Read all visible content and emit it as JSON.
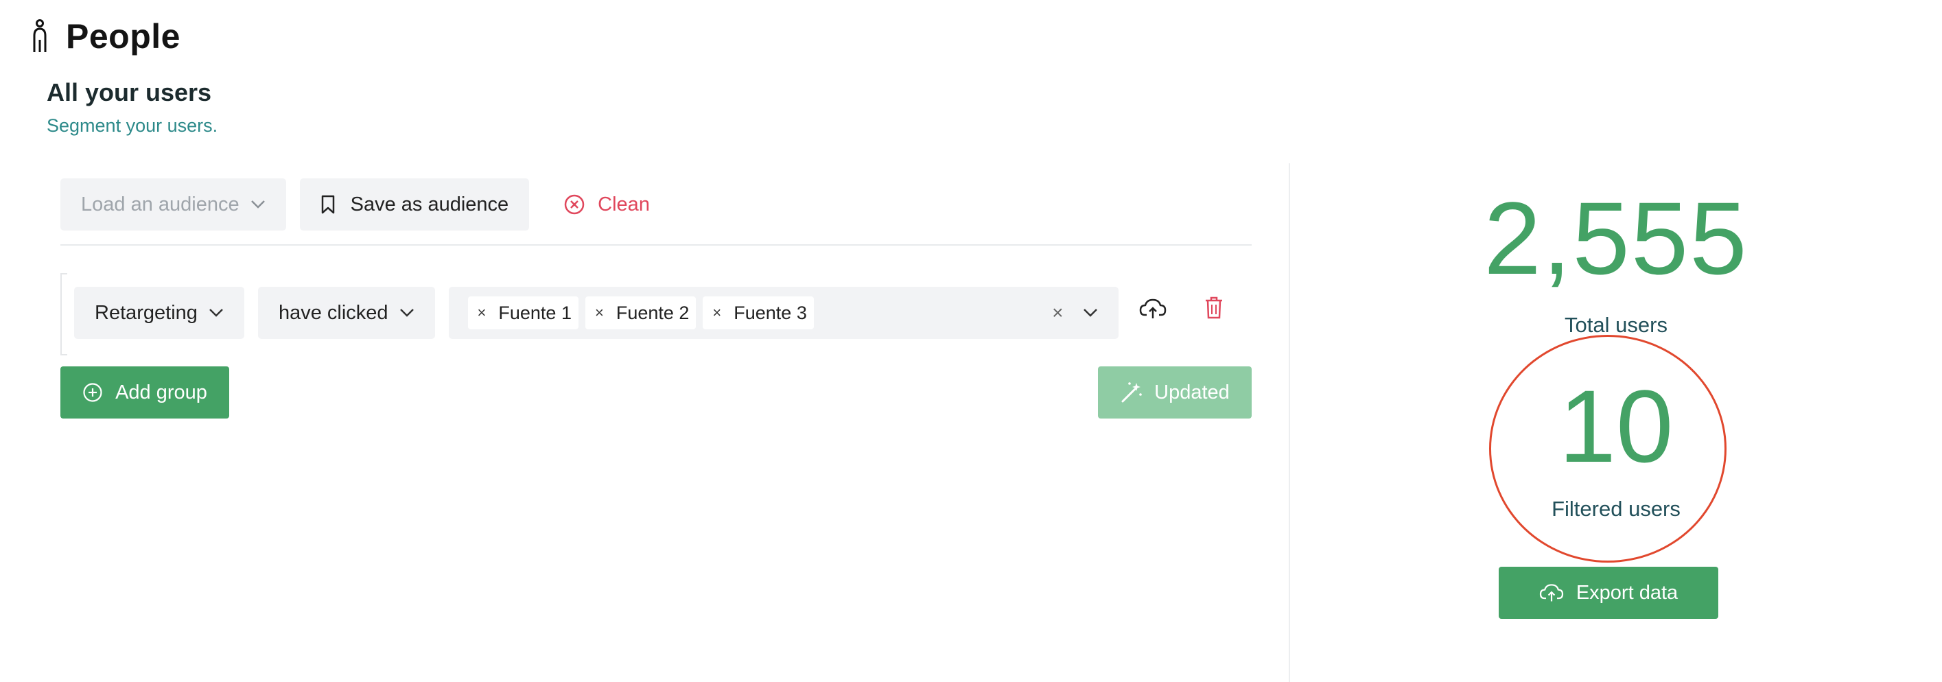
{
  "header": {
    "title": "People",
    "icon": "person-icon"
  },
  "section": {
    "title": "All your users",
    "subtitle": "Segment your users."
  },
  "toolbar": {
    "load_audience": {
      "label": "Load an audience",
      "icon": "chevron-down-icon"
    },
    "save_audience": {
      "label": "Save as audience",
      "icon": "bookmark-icon"
    },
    "clean": {
      "label": "Clean",
      "icon": "circle-x-icon",
      "color": "#e0475c"
    }
  },
  "rule": {
    "field": "Retargeting",
    "operator": "have clicked",
    "tags": [
      "Fuente 1",
      "Fuente 2",
      "Fuente 3"
    ],
    "clear_glyph": "×",
    "upload_icon": "cloud-upload-icon",
    "delete_icon": "trash-icon"
  },
  "actions": {
    "add_group": "Add group",
    "updated": "Updated"
  },
  "stats": {
    "total_count": "2,555",
    "total_label": "Total users",
    "filtered_count": "10",
    "filtered_label": "Filtered users",
    "export": "Export data"
  },
  "colors": {
    "accent_green": "#44a265",
    "disabled_green": "#8fcca4",
    "danger": "#e0475c",
    "highlight_circle": "#e1482e",
    "subtitle_teal": "#2d8a8a"
  }
}
